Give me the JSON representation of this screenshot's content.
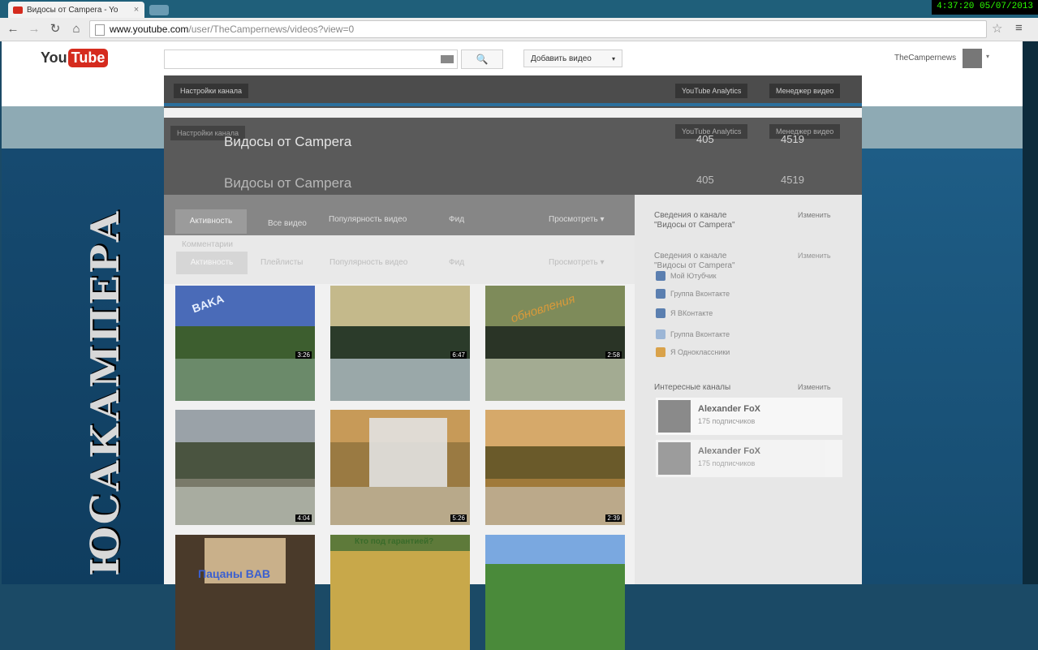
{
  "browser": {
    "tab_title": "Видосы от Campera - Yo",
    "tab_close": "×",
    "clock": "4:37:20  05/07/2013",
    "url_host": "www.youtube.com",
    "url_path": "/user/TheCampernews/videos?view=0",
    "nav": {
      "back": "←",
      "forward": "→",
      "reload": "↻",
      "home": "⌂"
    },
    "star": "☆",
    "menu": "≡"
  },
  "youtube": {
    "logo_you": "You",
    "logo_tube": "Tube",
    "search_icon": "🔍",
    "upload_label": "Добавить видео",
    "upload_caret": "▾",
    "username": "TheCampernews",
    "user_caret": "▾"
  },
  "channel": {
    "header_left": "Настройки канала",
    "header_analytics": "YouTube Analytics",
    "header_manager": "Менеджер видео",
    "ghost_left": "Настройки канала",
    "ghost_analytics": "YouTube Analytics",
    "ghost_manager": "Менеджер видео",
    "title": "Видосы от Campera",
    "subscribers": "405",
    "views": "4519",
    "side_title": "Видосы от Campera",
    "vertical_art": "ЮСАКАМПЕРА"
  },
  "tabs": {
    "active": "Активность",
    "all_videos": "Все видео",
    "popular": "Популярность видео",
    "feed": "Фид",
    "view": "Просмотреть ▾",
    "sub_active": "Активность",
    "sub_playlists": "Плейлисты",
    "sub_popular": "Популярность видео",
    "sub_feed": "Фид",
    "sub_view": "Просмотреть ▾",
    "sub_comments": "Комментарии"
  },
  "videos": [
    {
      "duration": "3:26"
    },
    {
      "duration": "6:47"
    },
    {
      "duration": "2:58"
    },
    {
      "duration": "4:04"
    },
    {
      "duration": "5:26"
    },
    {
      "duration": "2:39"
    },
    {
      "duration": ""
    },
    {
      "duration": ""
    },
    {
      "duration": ""
    }
  ],
  "thumb_texts": {
    "t1": "BAKA",
    "t3": "обновления",
    "t8": "Кто под гарантией?",
    "t7": "Пацаны BAB"
  },
  "sidebar": {
    "about_heading": "Сведения о канале",
    "about_name": "\"Видосы от Campera\"",
    "about_edit": "Изменить",
    "about_heading2": "Сведения о канале",
    "about_name2": "\"Видосы от Campera\"",
    "about_edit2": "Изменить",
    "social": [
      "Мой Ютубчик",
      "Группа Вконтакте",
      "Я ВКонтакте",
      "Группа Вконтакте",
      "Я Одноклассники"
    ],
    "interesting_heading": "Интересные каналы",
    "interesting_edit": "Изменить",
    "channels": [
      {
        "name": "Alexander FoX",
        "subs": "175 подписчиков"
      },
      {
        "name": "Alexander FoX",
        "subs": "175 подписчиков"
      }
    ]
  },
  "colors": {
    "youtube_red": "#d52b1e",
    "clock_green": "#2cff00",
    "link_blue": "#2b6f9c"
  }
}
